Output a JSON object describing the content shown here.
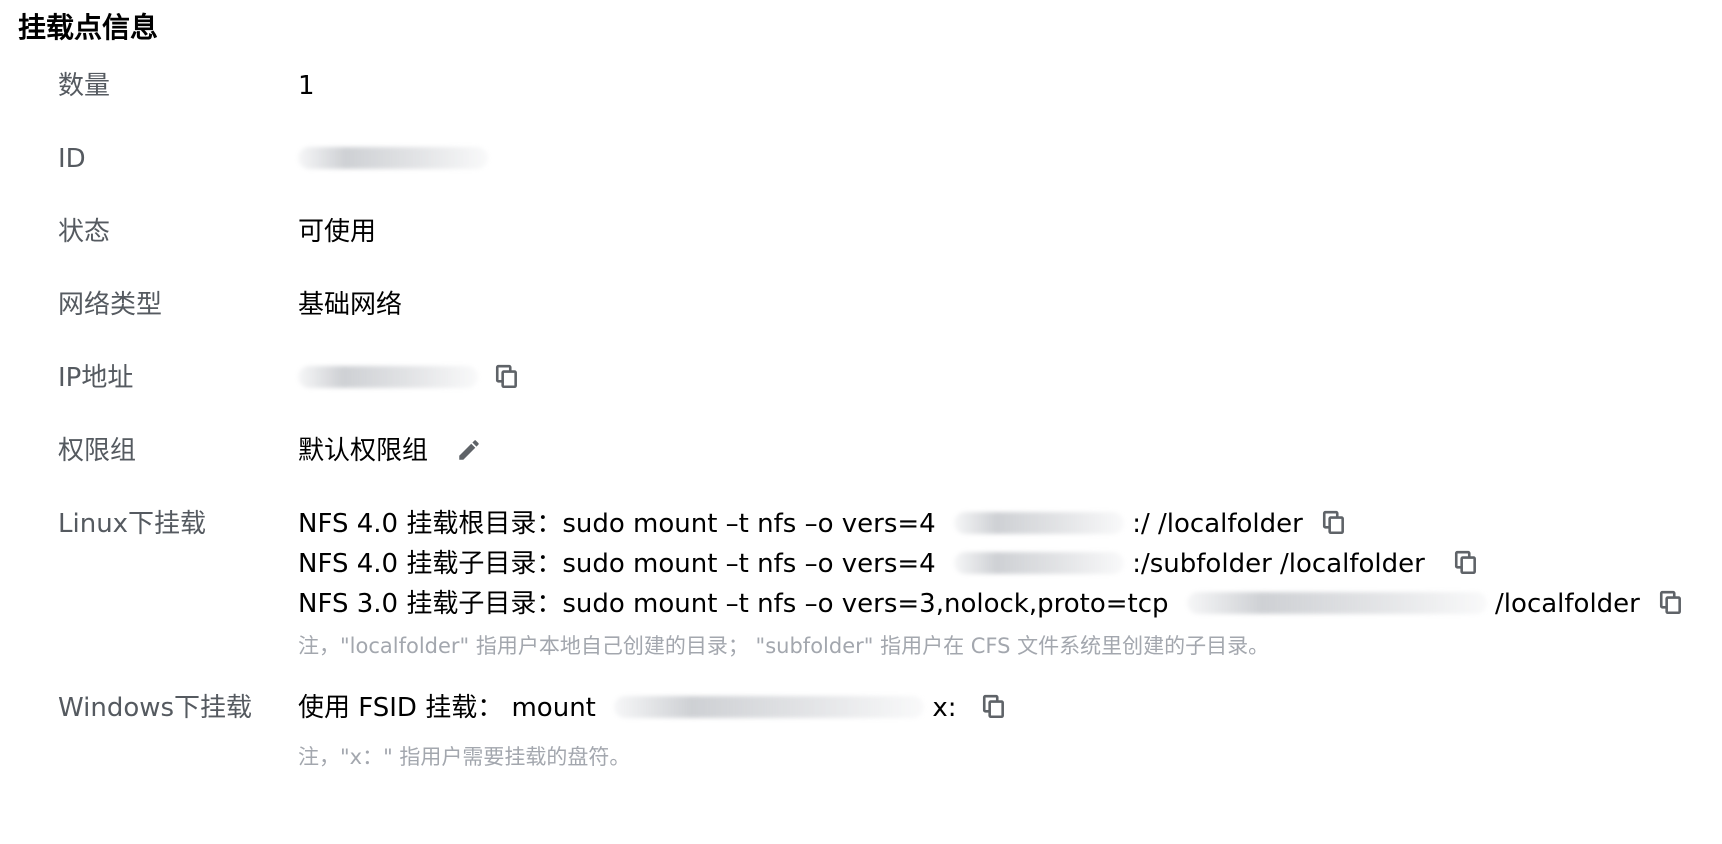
{
  "section": {
    "title": "挂载点信息"
  },
  "rows": {
    "count": {
      "label": "数量",
      "value": "1"
    },
    "id": {
      "label": "ID"
    },
    "status": {
      "label": "状态",
      "value": "可使用"
    },
    "network_type": {
      "label": "网络类型",
      "value": "基础网络"
    },
    "ip": {
      "label": "IP地址"
    },
    "permission_group": {
      "label": "权限组",
      "value": "默认权限组"
    },
    "linux_mount": {
      "label": "Linux下挂载",
      "lines": [
        {
          "prefix": "NFS 4.0 挂载根目录：sudo mount –t nfs –o vers=4",
          "suffix": ":/ /localfolder"
        },
        {
          "prefix": "NFS 4.0 挂载子目录：sudo mount –t nfs –o vers=4",
          "suffix": ":/subfolder /localfolder"
        },
        {
          "prefix": "NFS 3.0 挂载子目录：sudo mount –t nfs –o vers=3,nolock,proto=tcp",
          "suffix": "/localfolder"
        }
      ],
      "note": "注，\"localfolder\" 指用户本地自己创建的目录； \"subfolder\" 指用户在 CFS 文件系统里创建的子目录。"
    },
    "windows_mount": {
      "label": "Windows下挂载",
      "prefix": "使用 FSID 挂载： mount",
      "suffix": "x:",
      "note": "注，\"x：\" 指用户需要挂载的盘符。"
    }
  },
  "icons": {
    "copy": "copy-icon",
    "edit": "pencil-icon"
  },
  "colors": {
    "label": "#555a60",
    "value": "#000000",
    "note": "#a3a7ae",
    "icon": "#5f6368"
  }
}
